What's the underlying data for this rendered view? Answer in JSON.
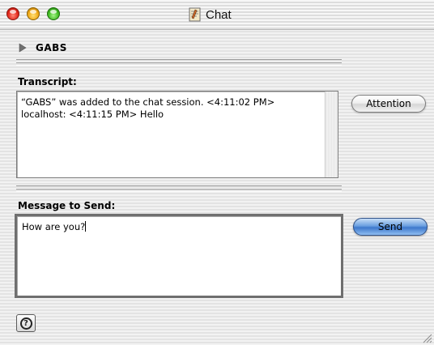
{
  "window": {
    "title": "Chat",
    "icon": "document-icon",
    "controls": [
      "close",
      "minimize",
      "zoom"
    ]
  },
  "participant": {
    "name": "GABS",
    "expanded": false
  },
  "transcript": {
    "label": "Transcript:",
    "lines": "“GABS” was added to the chat session. <4:11:02 PM>\nlocalhost: <4:11:15 PM> Hello"
  },
  "message": {
    "label": "Message to Send:",
    "value": "How are you?"
  },
  "buttons": {
    "attention": "Attention",
    "send": "Send",
    "help": "?"
  },
  "colors": {
    "send_accent": "#3d78cc",
    "close": "#e2261a",
    "minimize": "#f0a814",
    "zoom": "#3fbb21"
  }
}
